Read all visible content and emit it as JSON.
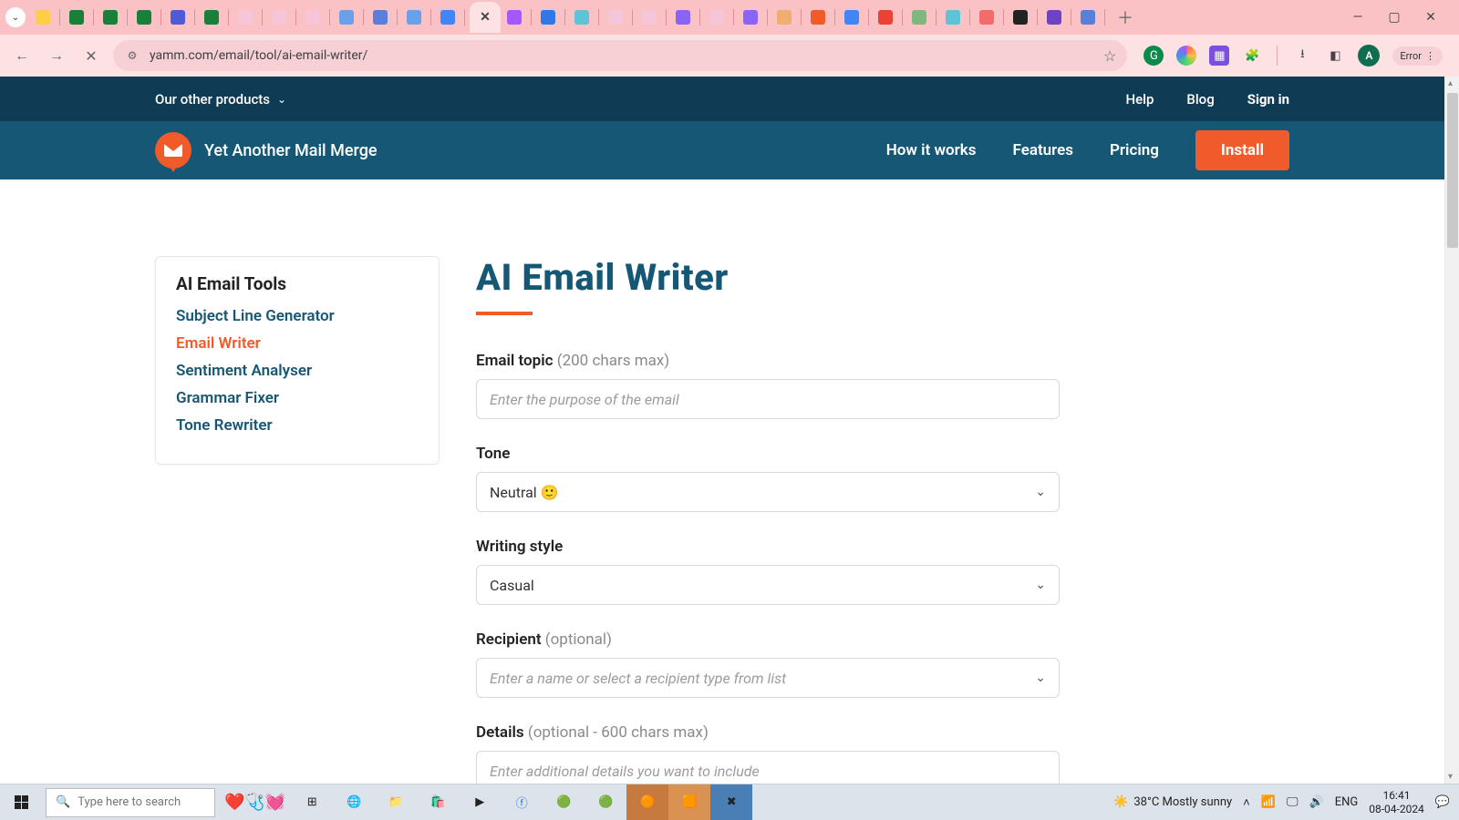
{
  "browser": {
    "url": "yamm.com/email/tool/ai-email-writer/",
    "error_label": "Error",
    "avatar_letter": "A"
  },
  "topbar": {
    "other_products": "Our other products",
    "help": "Help",
    "blog": "Blog",
    "signin": "Sign in"
  },
  "nav": {
    "brand": "Yet Another Mail Merge",
    "how": "How it works",
    "features": "Features",
    "pricing": "Pricing",
    "install": "Install"
  },
  "sidebar": {
    "title": "AI Email Tools",
    "items": [
      "Subject Line Generator",
      "Email Writer",
      "Sentiment Analyser",
      "Grammar Fixer",
      "Tone Rewriter"
    ],
    "active_index": 1
  },
  "page": {
    "title": "AI Email Writer",
    "fields": {
      "topic_label": "Email topic",
      "topic_hint": "(200 chars max)",
      "topic_placeholder": "Enter the purpose of the email",
      "tone_label": "Tone",
      "tone_value": "Neutral 🙂",
      "style_label": "Writing style",
      "style_value": "Casual",
      "recipient_label": "Recipient",
      "recipient_hint": "(optional)",
      "recipient_placeholder": "Enter a name or select a recipient type from list",
      "details_label": "Details",
      "details_hint": "(optional - 600 chars max)",
      "details_placeholder": "Enter additional details you want to include"
    }
  },
  "taskbar": {
    "search_placeholder": "Type here to search",
    "weather": "38°C  Mostly sunny",
    "lang": "ENG",
    "time": "16:41",
    "date": "08-04-2024"
  }
}
